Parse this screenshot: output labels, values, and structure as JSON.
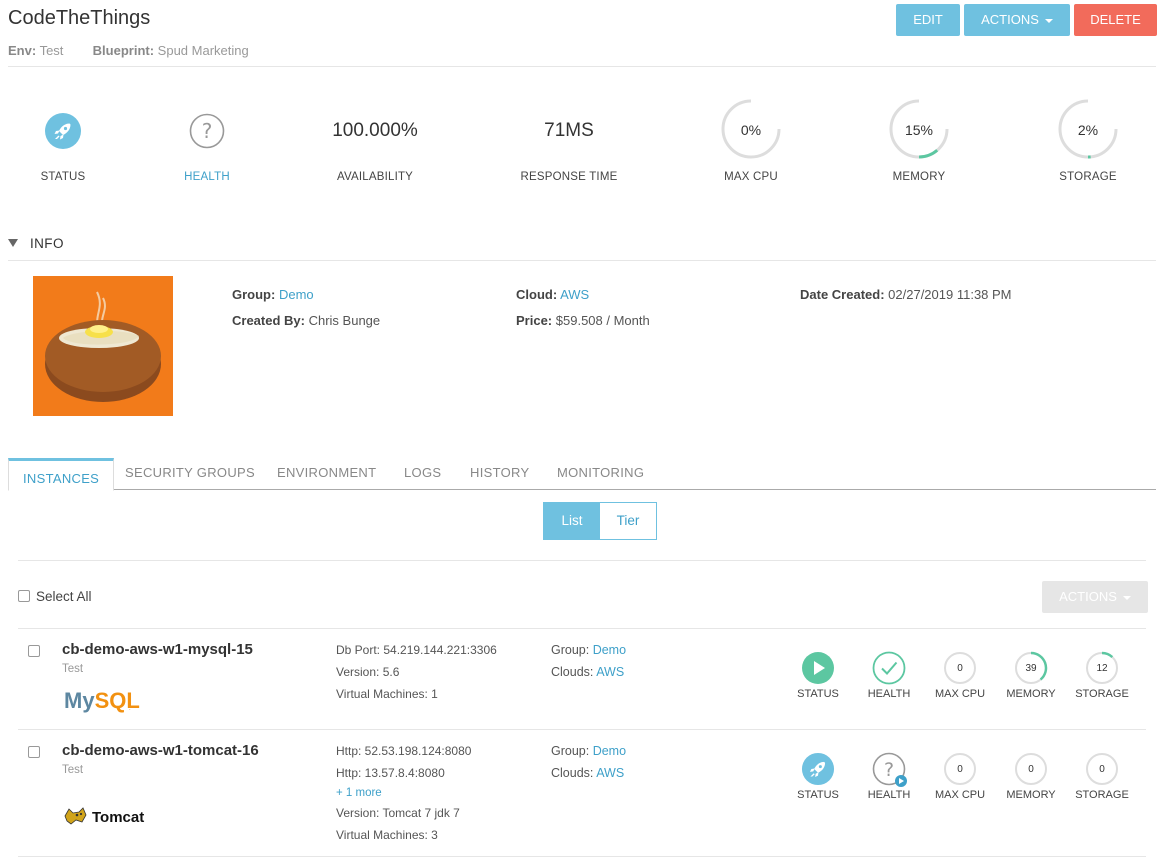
{
  "header": {
    "title": "CodeTheThings",
    "env_label": "Env:",
    "env_value": "Test",
    "blueprint_label": "Blueprint:",
    "blueprint_value": "Spud Marketing",
    "edit": "EDIT",
    "actions": "ACTIONS",
    "delete": "DELETE"
  },
  "stats": {
    "status_label": "STATUS",
    "health_label": "HEALTH",
    "health_icon": "?",
    "availability_value": "100.000%",
    "availability_label": "AVAILABILITY",
    "response_value": "71MS",
    "response_label": "RESPONSE TIME",
    "cpu_value": "0%",
    "cpu_label": "MAX CPU",
    "cpu_fraction": 0,
    "memory_value": "15%",
    "memory_label": "MEMORY",
    "memory_fraction": 0.15,
    "storage_value": "2%",
    "storage_label": "STORAGE",
    "storage_fraction": 0.02
  },
  "info": {
    "heading": "INFO",
    "group_label": "Group:",
    "group_value": "Demo",
    "created_by_label": "Created By:",
    "created_by_value": "Chris Bunge",
    "cloud_label": "Cloud:",
    "cloud_value": "AWS",
    "price_label": "Price:",
    "price_value": "$59.508 / Month",
    "date_label": "Date Created:",
    "date_value": "02/27/2019 11:38 PM"
  },
  "tabs": [
    "INSTANCES",
    "SECURITY GROUPS",
    "ENVIRONMENT",
    "LOGS",
    "HISTORY",
    "MONITORING"
  ],
  "view_toggle": {
    "list": "List",
    "tier": "Tier"
  },
  "list": {
    "select_all": "Select All",
    "actions": "ACTIONS"
  },
  "instances": [
    {
      "name": "cb-demo-aws-w1-mysql-15",
      "env": "Test",
      "logo": "MySQL",
      "details": [
        "Db Port: 54.219.144.221:3306",
        "Version: 5.6",
        "Virtual Machines: 1"
      ],
      "group_label": "Group:",
      "group_value": "Demo",
      "clouds_label": "Clouds:",
      "clouds_value": "AWS",
      "status_label": "STATUS",
      "health_label": "HEALTH",
      "cpu_label": "MAX CPU",
      "cpu_value": "0",
      "memory_label": "MEMORY",
      "memory_value": "39",
      "memory_fraction": 0.39,
      "storage_label": "STORAGE",
      "storage_value": "12",
      "storage_fraction": 0.12
    },
    {
      "name": "cb-demo-aws-w1-tomcat-16",
      "env": "Test",
      "logo": "Tomcat",
      "details": [
        "Http: 52.53.198.124:8080",
        "Http: 13.57.8.4:8080"
      ],
      "more": "+ 1 more",
      "details2": [
        "Version: Tomcat 7 jdk 7",
        "Virtual Machines: 3"
      ],
      "group_label": "Group:",
      "group_value": "Demo",
      "clouds_label": "Clouds:",
      "clouds_value": "AWS",
      "status_label": "STATUS",
      "health_label": "HEALTH",
      "health_icon": "?",
      "cpu_label": "MAX CPU",
      "cpu_value": "0",
      "memory_label": "MEMORY",
      "memory_value": "0",
      "memory_fraction": 0,
      "storage_label": "STORAGE",
      "storage_value": "0",
      "storage_fraction": 0
    }
  ],
  "colors": {
    "accent": "#6fc1e0",
    "link": "#3ea0c9",
    "delete": "#f26b5b",
    "success": "#5cc7a1",
    "gauge_track": "#dddddd"
  }
}
